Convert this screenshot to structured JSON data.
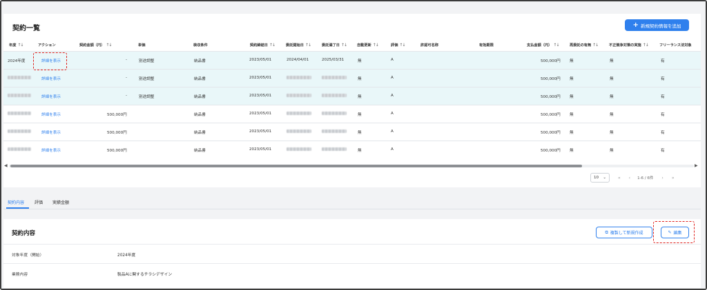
{
  "list": {
    "title": "契約一覧",
    "add_button": "新規契約情報を追加",
    "columns": [
      {
        "label": "年度",
        "sort": true
      },
      {
        "label": "アクション",
        "sort": false
      },
      {
        "label": "契約金額（円）",
        "sort": true
      },
      {
        "label": "単価",
        "sort": false
      },
      {
        "label": "検収条件",
        "sort": false
      },
      {
        "label": "契約締結日",
        "sort": true
      },
      {
        "label": "委託開始日",
        "sort": true
      },
      {
        "label": "委託満了日",
        "sort": true
      },
      {
        "label": "自動更新",
        "sort": true
      },
      {
        "label": "評価",
        "sort": true
      },
      {
        "label": "許認可名称",
        "sort": false
      },
      {
        "label": "有効期限",
        "sort": false
      },
      {
        "label": "支払金額（円）",
        "sort": true
      },
      {
        "label": "再委託の有無",
        "sort": true
      },
      {
        "label": "不正競争対策の実施",
        "sort": true
      },
      {
        "label": "フリーランス法対象",
        "sort": false
      }
    ],
    "rows": [
      {
        "year": "2024年度",
        "action": "詳細を表示",
        "amount": "",
        "unit": "-",
        "unit_note": "別途調整",
        "acceptance": "納品書",
        "signed": "2023/05/01",
        "start": "2024/04/01",
        "end": "2025/03/31",
        "auto": "無",
        "rating": "A",
        "permit": "",
        "expiry": "",
        "payment": "500,000円",
        "subcontract": "無",
        "fraud": "無",
        "freelance": "有"
      },
      {
        "year": "",
        "action": "詳細を表示",
        "amount": "",
        "unit": "-",
        "unit_note": "別途調整",
        "acceptance": "納品書",
        "signed": "2023/05/01",
        "start": "",
        "end": "",
        "auto": "無",
        "rating": "A",
        "permit": "",
        "expiry": "",
        "payment": "500,000円",
        "subcontract": "無",
        "fraud": "無",
        "freelance": "有"
      },
      {
        "year": "",
        "action": "詳細を表示",
        "amount": "",
        "unit": "-",
        "unit_note": "別途調整",
        "acceptance": "納品書",
        "signed": "2023/05/01",
        "start": "",
        "end": "",
        "auto": "無",
        "rating": "A",
        "permit": "",
        "expiry": "",
        "payment": "500,000円",
        "subcontract": "無",
        "fraud": "無",
        "freelance": "有"
      },
      {
        "year": "",
        "action": "詳細を表示",
        "amount": "500,000円",
        "unit": "",
        "unit_note": "",
        "acceptance": "納品書",
        "signed": "2023/05/01",
        "start": "",
        "end": "",
        "auto": "無",
        "rating": "A",
        "permit": "",
        "expiry": "",
        "payment": "500,000円",
        "subcontract": "無",
        "fraud": "無",
        "freelance": "有"
      },
      {
        "year": "",
        "action": "詳細を表示",
        "amount": "500,000円",
        "unit": "",
        "unit_note": "",
        "acceptance": "納品書",
        "signed": "2023/05/01",
        "start": "",
        "end": "",
        "auto": "無",
        "rating": "A",
        "permit": "",
        "expiry": "",
        "payment": "500,000円",
        "subcontract": "無",
        "fraud": "無",
        "freelance": "有"
      },
      {
        "year": "",
        "action": "詳細を表示",
        "amount": "500,000円",
        "unit": "",
        "unit_note": "",
        "acceptance": "納品書",
        "signed": "2023/05/01",
        "start": "",
        "end": "",
        "auto": "無",
        "rating": "A",
        "permit": "",
        "expiry": "",
        "payment": "500,000円",
        "subcontract": "無",
        "fraud": "無",
        "freelance": "有"
      }
    ],
    "pager": {
      "per_page": "10",
      "range": "1-6 / 6件"
    }
  },
  "tabs": [
    "契約内容",
    "評価",
    "実績金額"
  ],
  "detail": {
    "title": "契約内容",
    "copy_button": "複製して新規作成",
    "edit_button": "編集",
    "rows": [
      {
        "label": "対象年度（開始）",
        "value": "2024年度"
      },
      {
        "label": "業務内容",
        "value": "製品Aに関するチラシデザイン"
      }
    ]
  },
  "colors": {
    "accent": "#2f80ed",
    "highlight_row": "#e9f7f9",
    "annotation": "#e0201b"
  }
}
